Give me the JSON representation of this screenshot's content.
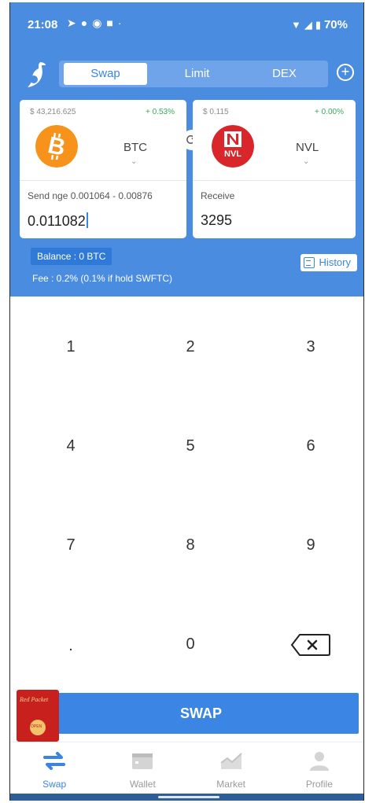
{
  "status_bar": {
    "time": "21:08",
    "notification_icons": [
      "telegram-icon",
      "messenger-icon",
      "facebook-icon",
      "youtube-icon",
      "dot-icon"
    ],
    "battery": "70%"
  },
  "header": {
    "tabs": [
      "Swap",
      "Limit",
      "DEX"
    ],
    "active_tab": "Swap"
  },
  "from_coin": {
    "price": "$ 43,216.625",
    "change": "+ 0.53%",
    "symbol": "BTC",
    "icon": "bitcoin-icon",
    "color": "#f7931a",
    "field_label": "Send   nge 0.001064 - 0.00876",
    "amount": "0.011082"
  },
  "to_coin": {
    "price": "$ 0.115",
    "change": "+ 0.00%",
    "symbol": "NVL",
    "icon": "nvl-icon",
    "color": "#d8262b",
    "field_label": "Receive",
    "amount": "3295"
  },
  "balance": "Balance : 0 BTC",
  "history_label": "History",
  "fee": "Fee : 0.2% (0.1% if hold SWFTC)",
  "keypad": [
    "1",
    "2",
    "3",
    "4",
    "5",
    "6",
    "7",
    "8",
    "9",
    ".",
    "0"
  ],
  "swap_button": "SWAP",
  "red_packet": {
    "label": "Red Packet",
    "seal": "OPEN"
  },
  "bottom_nav": [
    {
      "label": "Swap",
      "icon": "swap-icon",
      "active": true
    },
    {
      "label": "Wallet",
      "icon": "wallet-icon",
      "active": false
    },
    {
      "label": "Market",
      "icon": "market-icon",
      "active": false
    },
    {
      "label": "Profile",
      "icon": "profile-icon",
      "active": false
    }
  ],
  "colors": {
    "primary": "#4a8ce0",
    "button": "#3b86e4",
    "positive": "#39a85a"
  }
}
